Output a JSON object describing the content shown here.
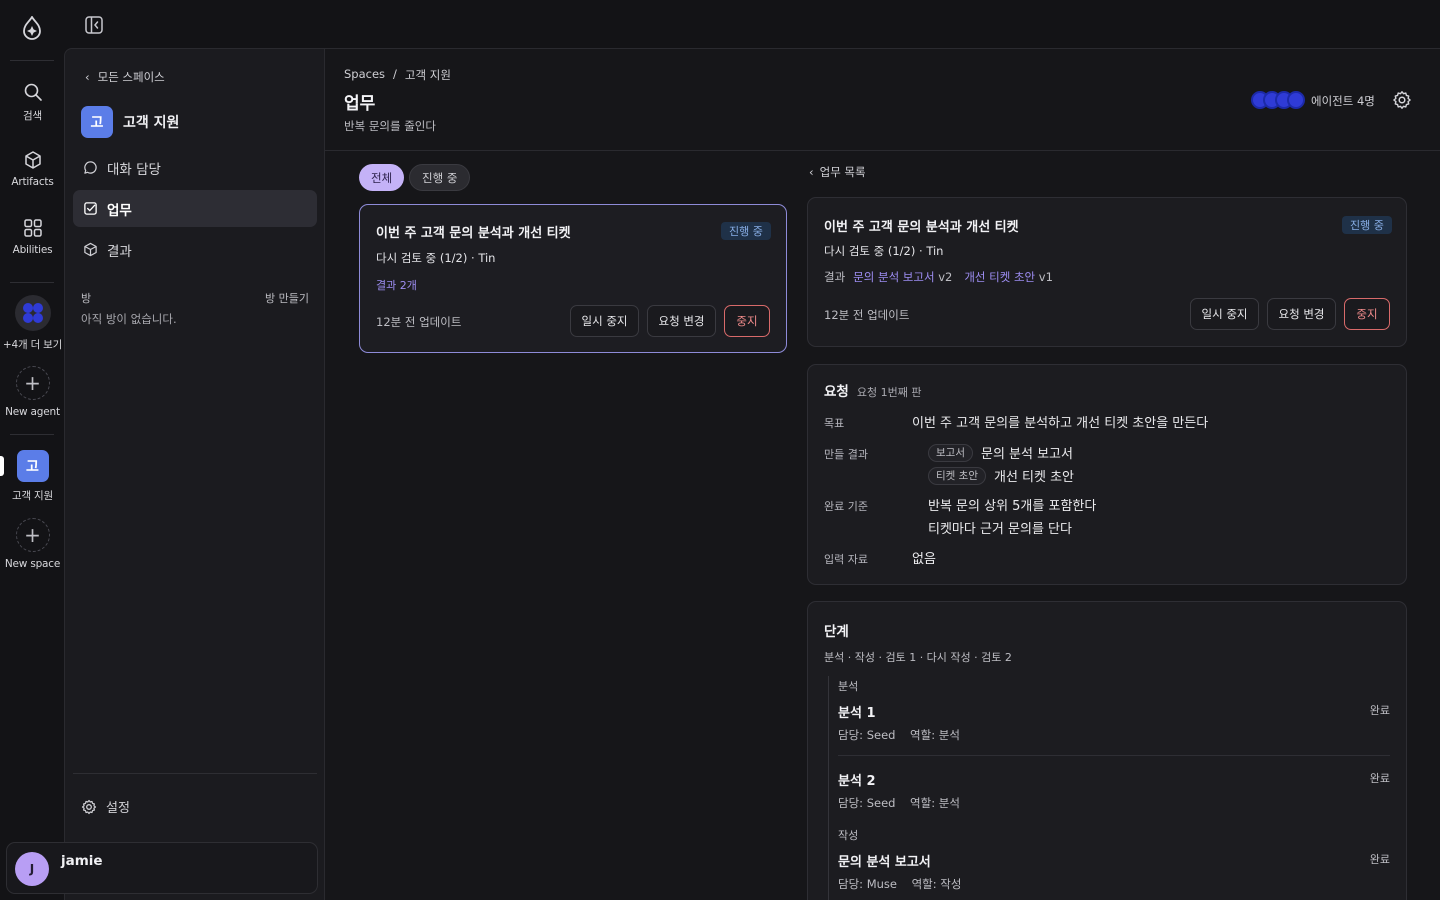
{
  "rail": {
    "search_label": "검색",
    "artifacts_label": "Artifacts",
    "abilities_label": "Abilities",
    "more_agents_label": "+4개 더 보기",
    "new_agent_label": "New agent",
    "space_badge": "고",
    "space_label": "고객 지원",
    "new_space_label": "New space"
  },
  "sidebar": {
    "back_label": "모든 스페이스",
    "space_initial": "고",
    "space_name": "고객 지원",
    "items": [
      {
        "label": "대화 담당",
        "icon": "chat-icon"
      },
      {
        "label": "업무",
        "icon": "task-check-icon"
      },
      {
        "label": "결과",
        "icon": "box-icon"
      }
    ],
    "rooms_title": "방",
    "rooms_create": "방 만들기",
    "rooms_empty": "아직 방이 없습니다.",
    "settings_label": "설정"
  },
  "user": {
    "initial": "J",
    "name": "jamie"
  },
  "header": {
    "crumb_root": "Spaces",
    "crumb_sep": "/",
    "crumb_current": "고객 지원",
    "title": "업무",
    "subtitle": "반복 문의를 줄인다",
    "agents_label": "에이전트 4명"
  },
  "filters": {
    "all": "전체",
    "active": "진행 중"
  },
  "task_card": {
    "title": "이번 주 고객 문의 분석과 개선 티켓",
    "status": "진행 중",
    "meta": "다시 검토 중 (1/2) · Tin",
    "results_link": "결과 2개",
    "updated": "12분 전 업데이트",
    "pause": "일시 중지",
    "change": "요청 변경",
    "stop": "중지"
  },
  "detail": {
    "back_label": "업무 목록",
    "title": "이번 주 고객 문의 분석과 개선 티켓",
    "status": "진행 중",
    "meta": "다시 검토 중 (1/2) · Tin",
    "results_label": "결과",
    "result_1": "문의 분석 보고서",
    "result_1_ver": "v2",
    "result_2": "개선 티켓 초안",
    "result_2_ver": "v1",
    "updated": "12분 전 업데이트",
    "pause": "일시 중지",
    "change": "요청 변경",
    "stop": "중지"
  },
  "request": {
    "title": "요청",
    "version": "요청 1번째 판",
    "goal_label": "목표",
    "goal": "이번 주 고객 문의를 분석하고 개선 티켓 초안을 만든다",
    "artifacts_label": "만들 결과",
    "artifacts": [
      {
        "tag": "보고서",
        "name": "문의 분석 보고서"
      },
      {
        "tag": "티켓 초안",
        "name": "개선 티켓 초안"
      }
    ],
    "criteria_label": "완료 기준",
    "criteria": [
      "반복 문의 상위 5개를 포함한다",
      "티켓마다 근거 문의를 단다"
    ],
    "input_label": "입력 자료",
    "input": "없음"
  },
  "steps": {
    "title": "단계",
    "summary": "분석 · 작성 · 검토 1 · 다시 작성 · 검토 2",
    "group_1": "분석",
    "step_1": {
      "name": "분석 1",
      "meta": "담당: Seed    역할: 분석",
      "status": "완료"
    },
    "step_2": {
      "name": "분석 2",
      "meta": "담당: Seed    역할: 분석",
      "status": "완료"
    },
    "group_2": "작성",
    "step_3": {
      "name": "문의 분석 보고서",
      "meta": "담당: Muse    역할: 작성",
      "status": "완료"
    }
  }
}
